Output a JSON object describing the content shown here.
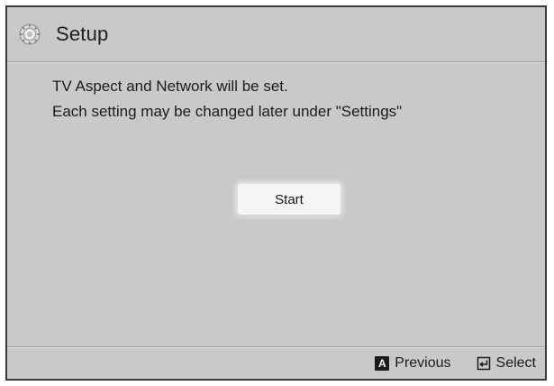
{
  "header": {
    "icon": "gear-icon",
    "title": "Setup"
  },
  "message": {
    "line1": "TV Aspect and Network will be set.",
    "line2": "Each setting may be changed later under \"Settings\""
  },
  "start_button": {
    "label": "Start"
  },
  "footer": {
    "previous": {
      "key": "A",
      "label": "Previous"
    },
    "select": {
      "icon": "enter-icon",
      "label": "Select"
    }
  },
  "colors": {
    "background": "#c9c9c9",
    "button": "#f5f5f5",
    "text": "#1b1b1b"
  }
}
